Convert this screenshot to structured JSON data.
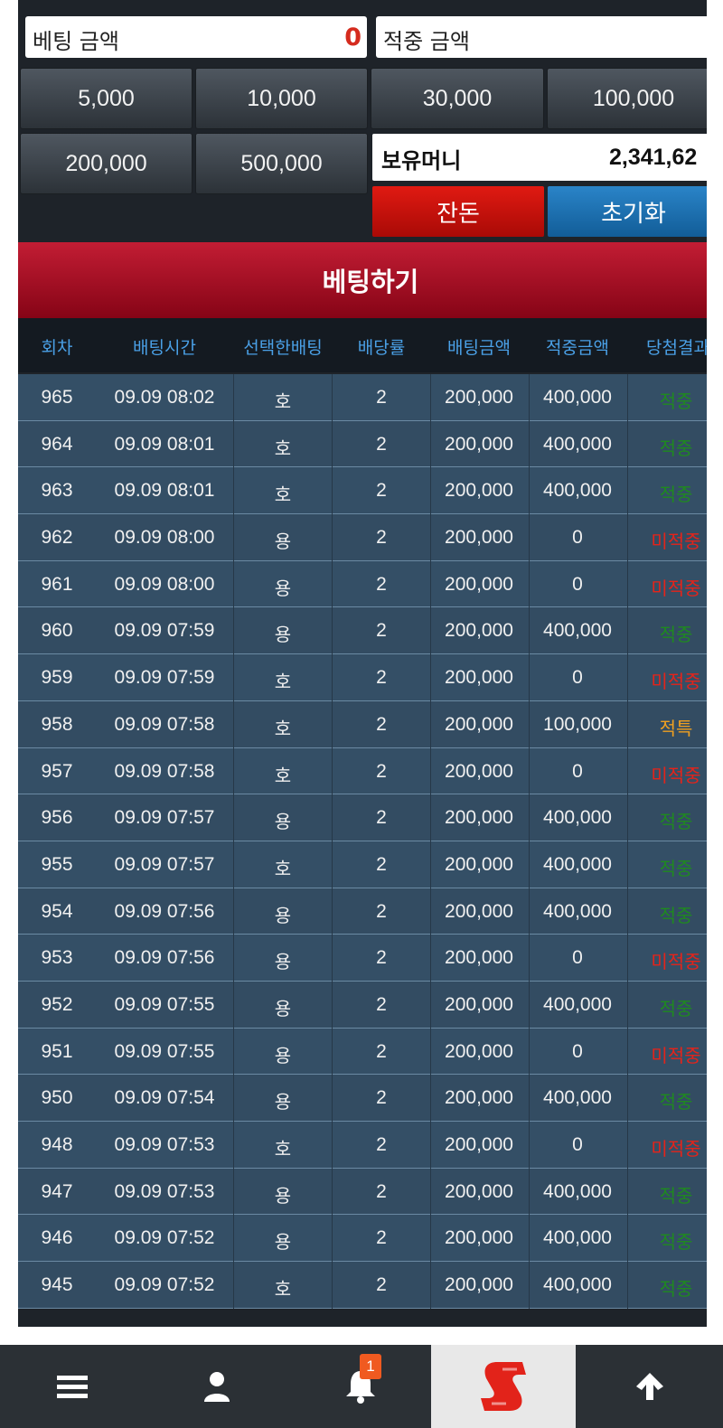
{
  "bet_amount": {
    "label": "베팅 금액",
    "value": "0"
  },
  "win_amount": {
    "label": "적중 금액",
    "value": ""
  },
  "chips": [
    "5,000",
    "10,000",
    "30,000",
    "100,000",
    "200,000",
    "500,000"
  ],
  "holding": {
    "label": "보유머니",
    "value": "2,341,62"
  },
  "buttons": {
    "change": "잔돈",
    "reset": "초기화",
    "bet": "베팅하기"
  },
  "table": {
    "headers": [
      "회차",
      "배팅시간",
      "선택한배팅",
      "배당률",
      "배팅금액",
      "적중금액",
      "당첨결과"
    ],
    "rows": [
      {
        "round": "965",
        "time": "09.09 08:02",
        "pick": "호",
        "odds": "2",
        "bet": "200,000",
        "win": "400,000",
        "result": "적중",
        "status": "hit"
      },
      {
        "round": "964",
        "time": "09.09 08:01",
        "pick": "호",
        "odds": "2",
        "bet": "200,000",
        "win": "400,000",
        "result": "적중",
        "status": "hit"
      },
      {
        "round": "963",
        "time": "09.09 08:01",
        "pick": "호",
        "odds": "2",
        "bet": "200,000",
        "win": "400,000",
        "result": "적중",
        "status": "hit"
      },
      {
        "round": "962",
        "time": "09.09 08:00",
        "pick": "용",
        "odds": "2",
        "bet": "200,000",
        "win": "0",
        "result": "미적중",
        "status": "miss"
      },
      {
        "round": "961",
        "time": "09.09 08:00",
        "pick": "용",
        "odds": "2",
        "bet": "200,000",
        "win": "0",
        "result": "미적중",
        "status": "miss"
      },
      {
        "round": "960",
        "time": "09.09 07:59",
        "pick": "용",
        "odds": "2",
        "bet": "200,000",
        "win": "400,000",
        "result": "적중",
        "status": "hit"
      },
      {
        "round": "959",
        "time": "09.09 07:59",
        "pick": "호",
        "odds": "2",
        "bet": "200,000",
        "win": "0",
        "result": "미적중",
        "status": "miss"
      },
      {
        "round": "958",
        "time": "09.09 07:58",
        "pick": "호",
        "odds": "2",
        "bet": "200,000",
        "win": "100,000",
        "result": "적특",
        "status": "spec"
      },
      {
        "round": "957",
        "time": "09.09 07:58",
        "pick": "호",
        "odds": "2",
        "bet": "200,000",
        "win": "0",
        "result": "미적중",
        "status": "miss"
      },
      {
        "round": "956",
        "time": "09.09 07:57",
        "pick": "용",
        "odds": "2",
        "bet": "200,000",
        "win": "400,000",
        "result": "적중",
        "status": "hit"
      },
      {
        "round": "955",
        "time": "09.09 07:57",
        "pick": "호",
        "odds": "2",
        "bet": "200,000",
        "win": "400,000",
        "result": "적중",
        "status": "hit"
      },
      {
        "round": "954",
        "time": "09.09 07:56",
        "pick": "용",
        "odds": "2",
        "bet": "200,000",
        "win": "400,000",
        "result": "적중",
        "status": "hit"
      },
      {
        "round": "953",
        "time": "09.09 07:56",
        "pick": "용",
        "odds": "2",
        "bet": "200,000",
        "win": "0",
        "result": "미적중",
        "status": "miss"
      },
      {
        "round": "952",
        "time": "09.09 07:55",
        "pick": "용",
        "odds": "2",
        "bet": "200,000",
        "win": "400,000",
        "result": "적중",
        "status": "hit"
      },
      {
        "round": "951",
        "time": "09.09 07:55",
        "pick": "용",
        "odds": "2",
        "bet": "200,000",
        "win": "0",
        "result": "미적중",
        "status": "miss"
      },
      {
        "round": "950",
        "time": "09.09 07:54",
        "pick": "용",
        "odds": "2",
        "bet": "200,000",
        "win": "400,000",
        "result": "적중",
        "status": "hit"
      },
      {
        "round": "948",
        "time": "09.09 07:53",
        "pick": "호",
        "odds": "2",
        "bet": "200,000",
        "win": "0",
        "result": "미적중",
        "status": "miss"
      },
      {
        "round": "947",
        "time": "09.09 07:53",
        "pick": "용",
        "odds": "2",
        "bet": "200,000",
        "win": "400,000",
        "result": "적중",
        "status": "hit"
      },
      {
        "round": "946",
        "time": "09.09 07:52",
        "pick": "용",
        "odds": "2",
        "bet": "200,000",
        "win": "400,000",
        "result": "적중",
        "status": "hit"
      },
      {
        "round": "945",
        "time": "09.09 07:52",
        "pick": "호",
        "odds": "2",
        "bet": "200,000",
        "win": "400,000",
        "result": "적중",
        "status": "hit"
      }
    ]
  },
  "nav": {
    "items": [
      {
        "icon": "menu-icon"
      },
      {
        "icon": "user-icon"
      },
      {
        "icon": "bell-icon",
        "badge": "1"
      },
      {
        "icon": "logo-s-icon"
      },
      {
        "icon": "arrow-up-icon"
      }
    ]
  },
  "colors": {
    "hit": "#1f8a1f",
    "miss": "#e5231a",
    "spec": "#f0a020",
    "header_text": "#4aa0e6"
  }
}
